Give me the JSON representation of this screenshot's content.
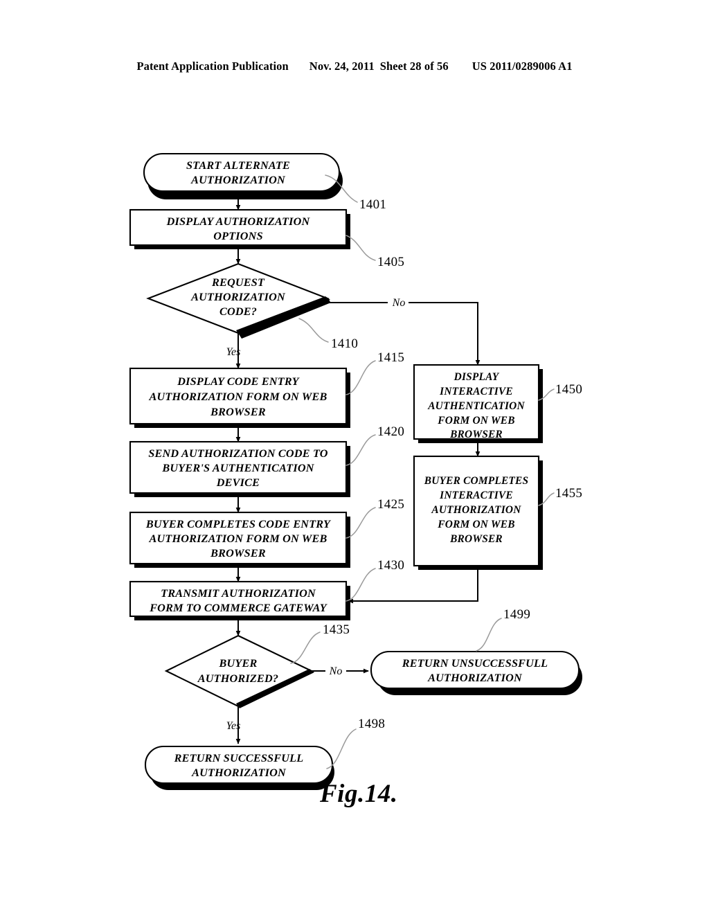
{
  "header": {
    "publication": "Patent Application Publication",
    "date": "Nov. 24, 2011",
    "sheet": "Sheet 28 of 56",
    "docnum": "US 2011/0289006 A1"
  },
  "figure": {
    "caption": "Fig.14."
  },
  "flowchart": {
    "type": "flowchart",
    "nodes": [
      {
        "id": "1401",
        "shape": "terminator",
        "lines": [
          "START ALTERNATE",
          "AUTHORIZATION"
        ]
      },
      {
        "id": "1405",
        "shape": "process",
        "lines": [
          "DISPLAY AUTHORIZATION",
          "OPTIONS"
        ]
      },
      {
        "id": "1410",
        "shape": "decision",
        "lines": [
          "REQUEST",
          "AUTHORIZATION",
          "CODE?"
        ]
      },
      {
        "id": "1415",
        "shape": "process",
        "lines": [
          "DISPLAY CODE ENTRY",
          "AUTHORIZATION FORM  ON  WEB",
          "BROWSER"
        ]
      },
      {
        "id": "1420",
        "shape": "process",
        "lines": [
          "SEND AUTHORIZATION CODE TO",
          "BUYER'S AUTHENTICATION",
          "DEVICE"
        ]
      },
      {
        "id": "1425",
        "shape": "process",
        "lines": [
          "BUYER COMPLETES CODE ENTRY",
          "AUTHORIZATION  FORM ON WEB",
          "BROWSER"
        ]
      },
      {
        "id": "1430",
        "shape": "process",
        "lines": [
          "TRANSMIT AUTHORIZATION",
          "FORM TO COMMERCE GATEWAY"
        ]
      },
      {
        "id": "1435",
        "shape": "decision",
        "lines": [
          "BUYER",
          "AUTHORIZED?"
        ]
      },
      {
        "id": "1450",
        "shape": "process",
        "lines": [
          "DISPLAY",
          "INTERACTIVE",
          "AUTHENTICATION",
          "FORM ON WEB",
          "BROWSER"
        ]
      },
      {
        "id": "1455",
        "shape": "process",
        "lines": [
          "BUYER COMPLETES",
          "INTERACTIVE",
          "AUTHORIZATION",
          "FORM ON WEB",
          "BROWSER"
        ]
      },
      {
        "id": "1498",
        "shape": "terminator",
        "lines": [
          "RETURN SUCCESSFULL",
          "AUTHORIZATION"
        ]
      },
      {
        "id": "1499",
        "shape": "terminator",
        "lines": [
          "RETURN UNSUCCESSFULL",
          "AUTHORIZATION"
        ]
      }
    ],
    "branch_labels": [
      {
        "id": "no-1410",
        "text": "No"
      },
      {
        "id": "yes-1410",
        "text": "Yes"
      },
      {
        "id": "no-1435",
        "text": "No"
      },
      {
        "id": "yes-1435",
        "text": "Yes"
      }
    ],
    "reference_numerals": [
      "1401",
      "1405",
      "1410",
      "1415",
      "1420",
      "1425",
      "1430",
      "1435",
      "1450",
      "1455",
      "1498",
      "1499"
    ]
  }
}
